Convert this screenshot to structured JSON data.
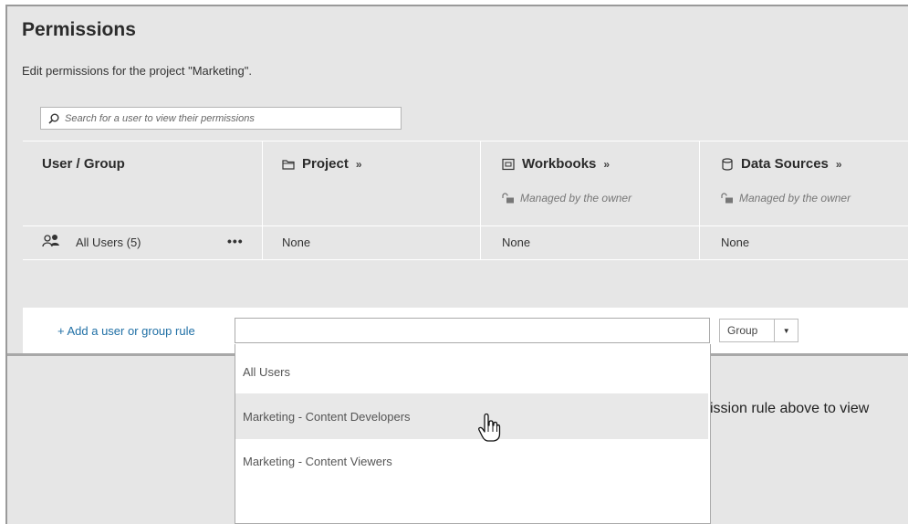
{
  "page": {
    "title": "Permissions",
    "subtitle": "Edit permissions for the project \"Marketing\"."
  },
  "search": {
    "placeholder": "Search for a user to view their permissions"
  },
  "columns": [
    {
      "label": "User / Group",
      "icon": ""
    },
    {
      "label": "Project",
      "icon": "folder-icon"
    },
    {
      "label": "Workbooks",
      "icon": "workbook-icon",
      "managed": "Managed by the owner"
    },
    {
      "label": "Data Sources",
      "icon": "database-icon",
      "managed": "Managed by the owner"
    }
  ],
  "rows": [
    {
      "user": "All Users (5)",
      "user_icon": "group-icon",
      "project": "None",
      "workbooks": "None",
      "data_sources": "None"
    }
  ],
  "add_rule": {
    "link_label": "+ Add a user or group rule",
    "input_value": "",
    "type_select": "Group"
  },
  "dropdown": {
    "options": [
      "All Users",
      "Marketing - Content Developers",
      "Marketing - Content Viewers"
    ],
    "hovered_index": 1
  },
  "below_message": "ission rule above to view",
  "colors": {
    "link": "#1f6fa5",
    "panel_bg": "#e6e6e6",
    "hover_bg": "#e8e8e8"
  }
}
